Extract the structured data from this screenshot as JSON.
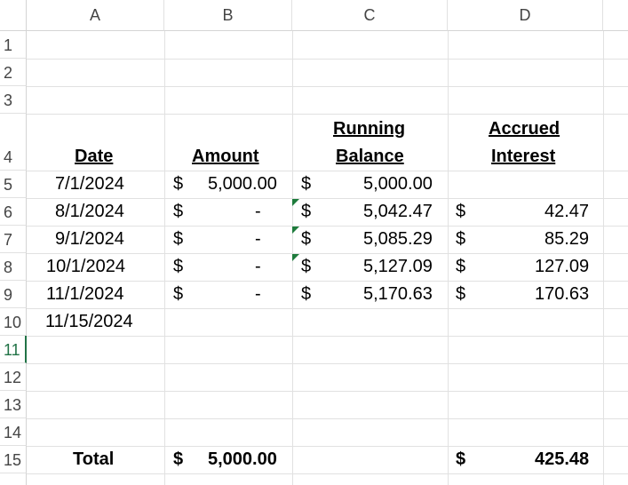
{
  "columns": [
    "A",
    "B",
    "C",
    "D"
  ],
  "rows": [
    "1",
    "2",
    "3",
    "4",
    "5",
    "6",
    "7",
    "8",
    "9",
    "10",
    "11",
    "12",
    "13",
    "14",
    "15"
  ],
  "selected_row": "11",
  "headers": {
    "date": "Date",
    "amount": "Amount",
    "running_1": "Running",
    "running_2": "Balance",
    "accrued_1": "Accrued",
    "accrued_2": "Interest"
  },
  "currency": "$",
  "data_rows": [
    {
      "date": "7/1/2024",
      "amount": "5,000.00",
      "balance": "5,000.00",
      "interest": ""
    },
    {
      "date": "8/1/2024",
      "amount": "-",
      "balance": "5,042.47",
      "interest": "42.47"
    },
    {
      "date": "9/1/2024",
      "amount": "-",
      "balance": "5,085.29",
      "interest": "85.29"
    },
    {
      "date": "10/1/2024",
      "amount": "-",
      "balance": "5,127.09",
      "interest": "127.09"
    },
    {
      "date": "11/1/2024",
      "amount": "-",
      "balance": "5,170.63",
      "interest": "170.63"
    }
  ],
  "last_date": "11/15/2024",
  "total": {
    "label": "Total",
    "amount": "5,000.00",
    "interest": "425.48"
  },
  "colors": {
    "accent": "#217346",
    "error_triangle": "#1e7b3c",
    "gridline": "#e1e1e1"
  }
}
